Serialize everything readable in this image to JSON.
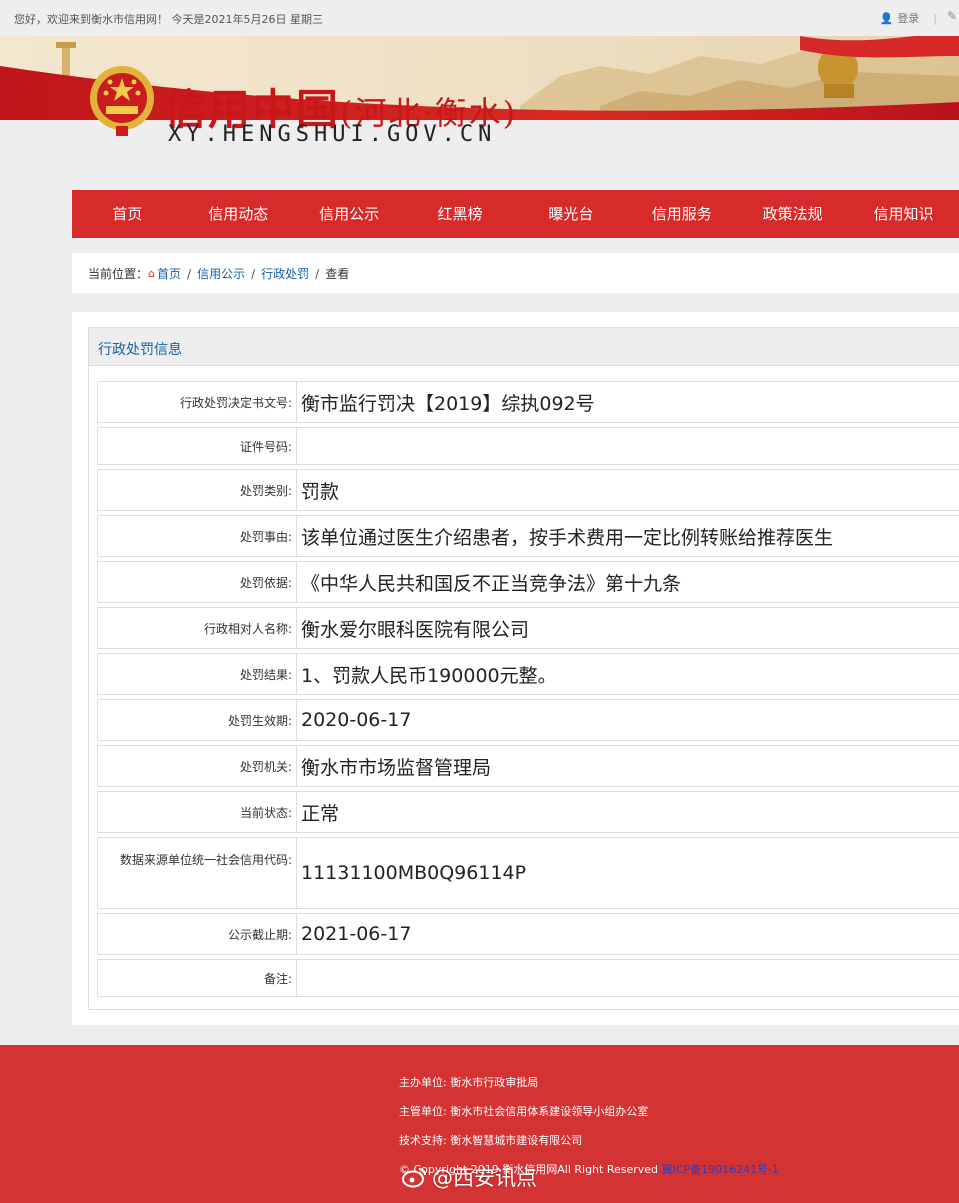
{
  "topbar": {
    "welcome": "您好，欢迎来到衡水市信用网！ 今天是2021年5月26日 星期三",
    "login_label": "登录",
    "separator": "|"
  },
  "site": {
    "title_main": "信用中国",
    "title_sub": "(河北·衡水)",
    "domain": "XY.HENGSHUI.GOV.CN"
  },
  "nav": {
    "items": [
      {
        "label": "首页"
      },
      {
        "label": "信用动态"
      },
      {
        "label": "信用公示"
      },
      {
        "label": "红黑榜"
      },
      {
        "label": "曝光台"
      },
      {
        "label": "信用服务"
      },
      {
        "label": "政策法规"
      },
      {
        "label": "信用知识"
      }
    ]
  },
  "breadcrumb": {
    "prefix": "当前位置：",
    "home": "首页",
    "level1": "信用公示",
    "level2": "行政处罚",
    "current": "查看",
    "separator": "/"
  },
  "panel": {
    "title": "行政处罚信息",
    "rows": [
      {
        "label": "行政处罚决定书文号:",
        "value": "衡市监行罚决【2019】综执092号"
      },
      {
        "label": "证件号码:",
        "value": ""
      },
      {
        "label": "处罚类别:",
        "value": "罚款"
      },
      {
        "label": "处罚事由:",
        "value": "该单位通过医生介绍患者，按手术费用一定比例转账给推荐医生"
      },
      {
        "label": "处罚依据:",
        "value": "《中华人民共和国反不正当竞争法》第十九条"
      },
      {
        "label": "行政相对人名称:",
        "value": "衡水爱尔眼科医院有限公司"
      },
      {
        "label": "处罚结果:",
        "value": "1、罚款人民币190000元整。"
      },
      {
        "label": "处罚生效期:",
        "value": "2020-06-17"
      },
      {
        "label": "处罚机关:",
        "value": "衡水市市场监督管理局"
      },
      {
        "label": "当前状态:",
        "value": "正常"
      },
      {
        "label": "数据来源单位统一社会信用代码:",
        "value": "11131100MB0Q96114P"
      },
      {
        "label": "公示截止期:",
        "value": "2021-06-17"
      },
      {
        "label": "备注:",
        "value": ""
      }
    ]
  },
  "footer": {
    "host": "主办单位:   衡水市行政审批局",
    "supervisor": "主管单位:   衡水市社会信用体系建设领导小组办公室",
    "tech": "技术支持:   衡水智慧城市建设有限公司",
    "copyright": "© Copyright 2019 衡水信用网All Right Reserved",
    "icp": "冀ICP备19016241号-1"
  },
  "watermark": {
    "text": "@西安讯点"
  },
  "colors": {
    "brand_red": "#d72b2b",
    "footer_red": "#d33333",
    "link_blue": "#1a5fa8"
  }
}
